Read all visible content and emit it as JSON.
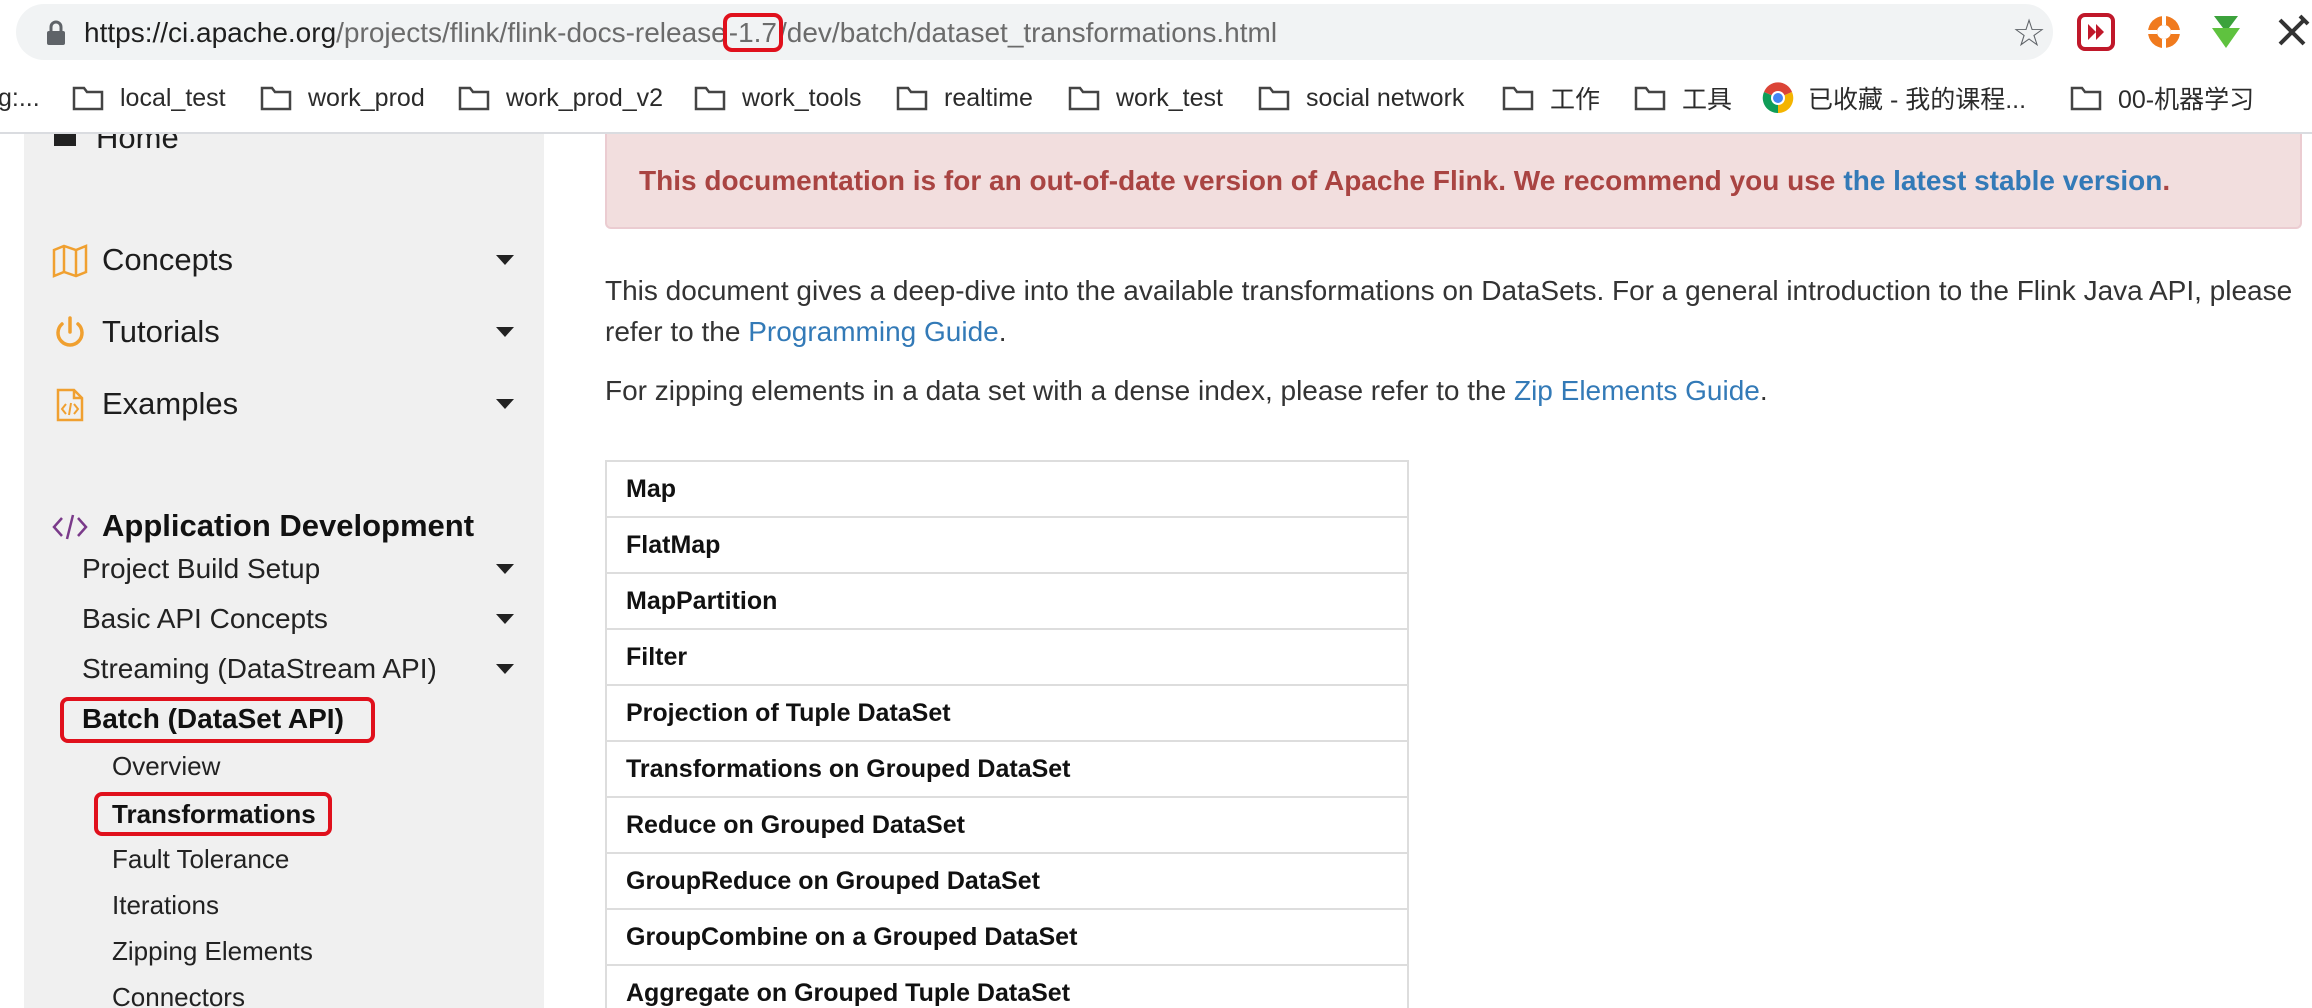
{
  "browser": {
    "url_host": "https://ci.apache.org",
    "url_path_before": "/projects/flink/flink-docs-release",
    "url_highlight": "-1.7",
    "url_path_after": "/dev/batch/dataset_transformations.html",
    "star_icon": "star-icon"
  },
  "bookmarks": [
    {
      "label": "g:...",
      "icon": "none"
    },
    {
      "label": "local_test",
      "icon": "folder-icon"
    },
    {
      "label": "work_prod",
      "icon": "folder-icon"
    },
    {
      "label": "work_prod_v2",
      "icon": "folder-icon"
    },
    {
      "label": "work_tools",
      "icon": "folder-icon"
    },
    {
      "label": "realtime",
      "icon": "folder-icon"
    },
    {
      "label": "work_test",
      "icon": "folder-icon"
    },
    {
      "label": "social network",
      "icon": "folder-icon"
    },
    {
      "label": "工作",
      "icon": "folder-icon"
    },
    {
      "label": "工具",
      "icon": "folder-icon"
    },
    {
      "label": "已收藏 - 我的课程...",
      "icon": "chrome-icon"
    },
    {
      "label": "00-机器学习",
      "icon": "folder-icon"
    }
  ],
  "sidebar": {
    "home_partial": "Home",
    "sections": [
      {
        "label": "Concepts",
        "icon": "map-icon"
      },
      {
        "label": "Tutorials",
        "icon": "power-icon"
      },
      {
        "label": "Examples",
        "icon": "code-file-icon"
      }
    ],
    "app_dev": {
      "label": "Application Development",
      "icon": "code-icon"
    },
    "app_dev_items": [
      {
        "label": "Project Build Setup"
      },
      {
        "label": "Basic API Concepts"
      },
      {
        "label": "Streaming (DataStream API)"
      },
      {
        "label": "Batch (DataSet API)"
      }
    ],
    "batch_items": [
      {
        "label": "Overview"
      },
      {
        "label": "Transformations"
      },
      {
        "label": "Fault Tolerance"
      },
      {
        "label": "Iterations"
      },
      {
        "label": "Zipping Elements"
      },
      {
        "label": "Connectors"
      }
    ]
  },
  "main": {
    "warning_text": "This documentation is for an out-of-date version of Apache Flink. We recommend you use",
    "warning_link": "the latest stable version",
    "warning_end": ".",
    "intro_text": "This document gives a deep-dive into the available transformations on DataSets. For a general introduction to the Flink Java API, please refer to the",
    "intro_link": "Programming Guide",
    "intro_end": ".",
    "zip_text": "For zipping elements in a data set with a dense index, please refer to the",
    "zip_link": "Zip Elements Guide",
    "zip_end": ".",
    "transformations": [
      "Map",
      "FlatMap",
      "MapPartition",
      "Filter",
      "Projection of Tuple DataSet",
      "Transformations on Grouped DataSet",
      "Reduce on Grouped DataSet",
      "GroupReduce on Grouped DataSet",
      "GroupCombine on a Grouped DataSet",
      "Aggregate on Grouped Tuple DataSet"
    ]
  },
  "colors": {
    "highlight_red": "#e0101c",
    "link_blue": "#337ab7",
    "warning_bg": "#f2dede",
    "warning_text": "#a94442",
    "sidebar_bg": "#f0f0f0",
    "icon_orange": "#f0a030"
  }
}
